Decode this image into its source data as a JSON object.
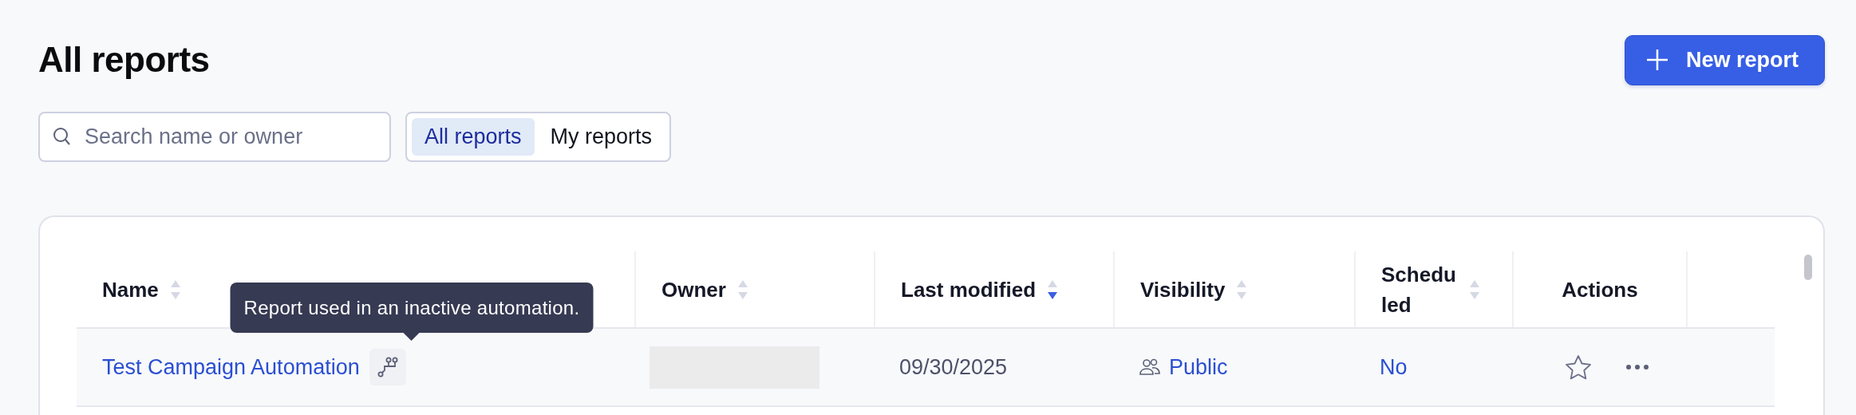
{
  "page": {
    "title": "All reports"
  },
  "new_report_button": {
    "label": "New report"
  },
  "search": {
    "placeholder": "Search name or owner"
  },
  "filter_tabs": [
    {
      "label": "All reports",
      "selected": true
    },
    {
      "label": "My reports",
      "selected": false
    }
  ],
  "table": {
    "columns": [
      {
        "label": "Name",
        "sorted_asc": false,
        "sorted_desc": false
      },
      {
        "label": "Owner",
        "sorted_asc": false,
        "sorted_desc": false
      },
      {
        "label": "Last modified",
        "sorted_asc": false,
        "sorted_desc": true
      },
      {
        "label": "Visibility",
        "sorted_asc": false,
        "sorted_desc": false
      },
      {
        "label": "Scheduled",
        "sorted_asc": false,
        "sorted_desc": false
      },
      {
        "label": "Actions"
      }
    ],
    "rows": [
      {
        "name": "Test Campaign Automation",
        "automation": true,
        "owner_redacted": true,
        "last_modified": "09/30/2025",
        "visibility": "Public",
        "scheduled": "No",
        "starred": false
      }
    ]
  },
  "tooltip": {
    "text": "Report used in an inactive automation."
  }
}
